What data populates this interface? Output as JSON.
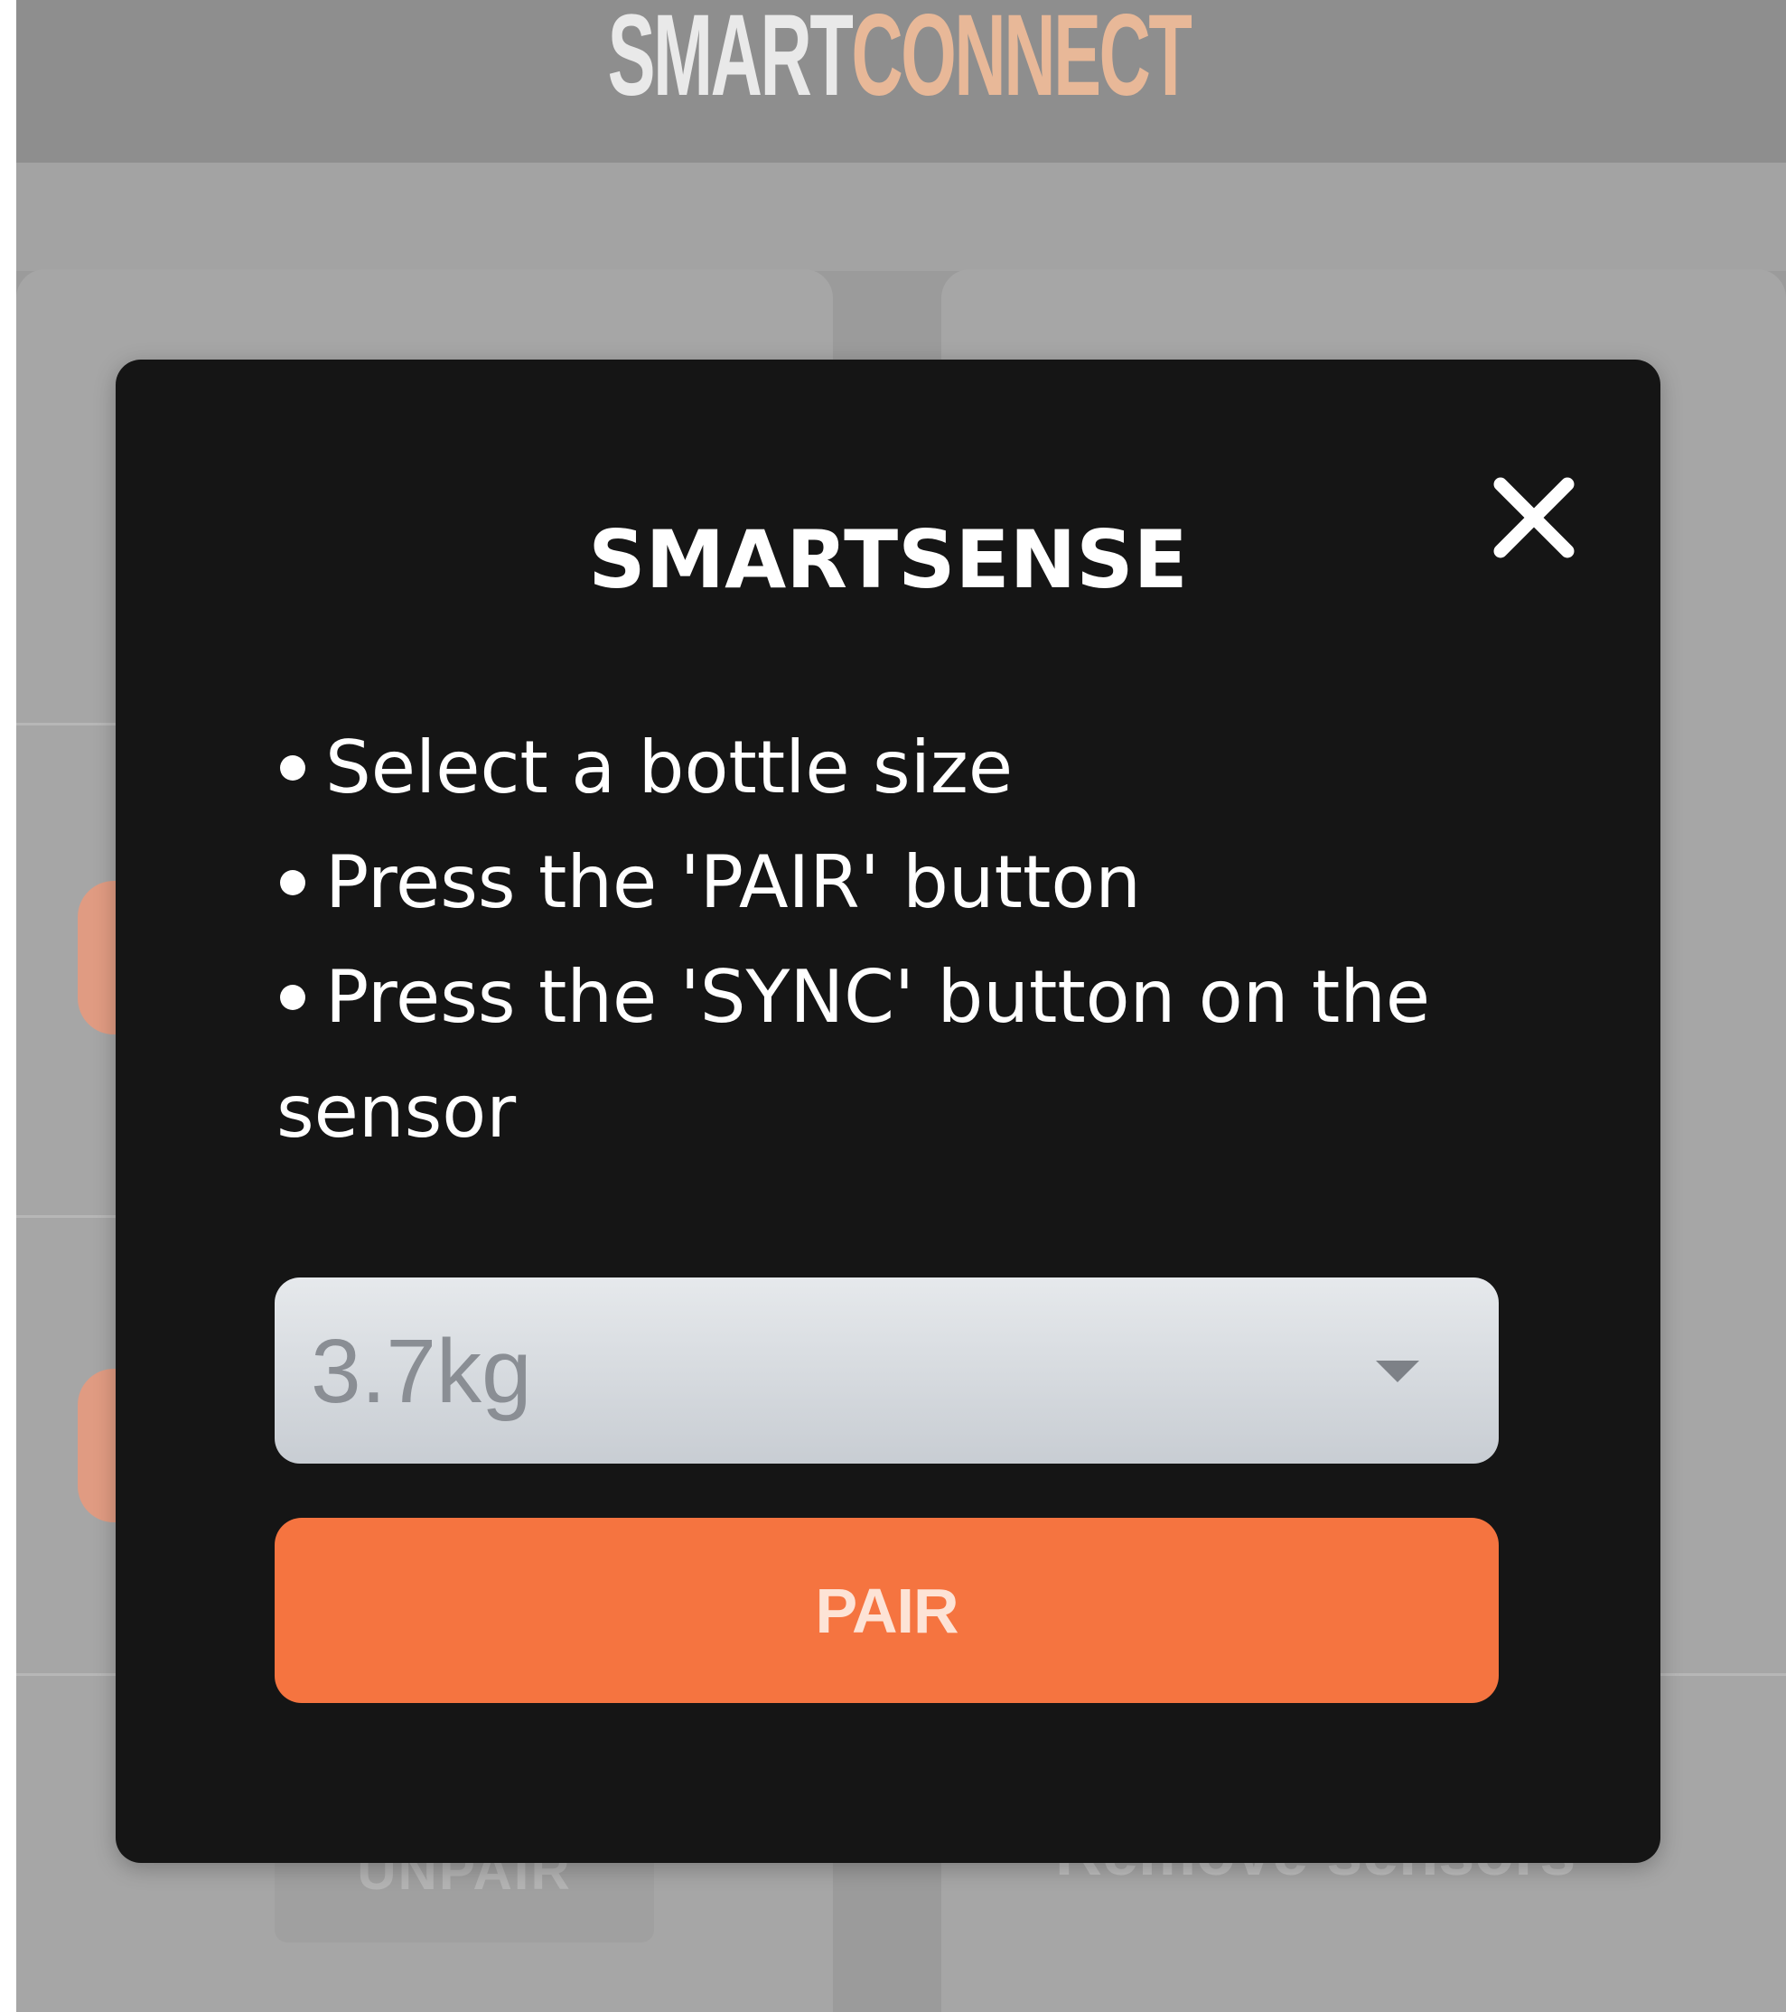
{
  "header": {
    "logo_part1": "SMART",
    "logo_part2": "CONNECT"
  },
  "background": {
    "unpair_label": "UNPAIR",
    "remove_sensors_label": "Remove sensors"
  },
  "modal": {
    "title": "SMARTSENSE",
    "close_icon": "close-icon",
    "steps": [
      "Select a bottle size",
      "Press the 'PAIR' button",
      "Press the 'SYNC' button on the sensor"
    ],
    "bottle_size": {
      "selected": "3.7kg"
    },
    "pair_label": "PAIR"
  },
  "colors": {
    "accent": "#f57440",
    "logo_accent": "#e8b898",
    "modal_bg": "#151515",
    "overlay_bg": "#9b9b9b"
  }
}
